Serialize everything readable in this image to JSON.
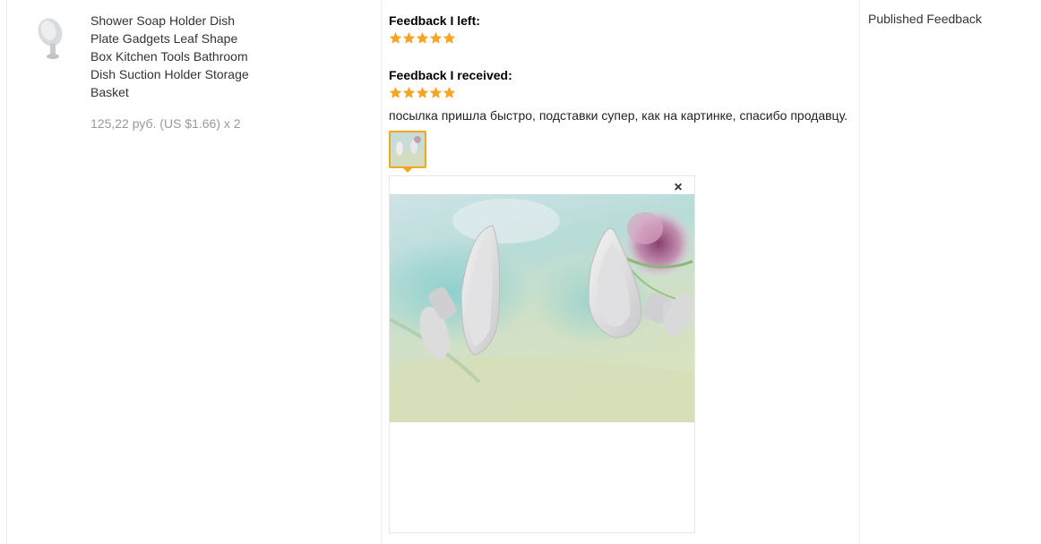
{
  "product": {
    "image": "soap-holder-product-image",
    "title": "Shower Soap Holder Dish Plate Gadgets Leaf Shape Box Kitchen Tools Bathroom Dish Suction Holder Storage Basket",
    "price": "125,22 руб. (US $1.66) x 2"
  },
  "feedback": {
    "left_label": "Feedback I left:",
    "left_rating": 5,
    "received_label": "Feedback I received:",
    "received_rating": 5,
    "star_color": "#f5a623",
    "comment": "посылка пришла быстро, подставки супер, как на картинке, спасибо продавцу.",
    "photo": "buyer-photo-soap-holders",
    "thumb_border_color": "#f0a91e",
    "close_symbol": "×"
  },
  "actions": {
    "published_label": "Published Feedback"
  }
}
